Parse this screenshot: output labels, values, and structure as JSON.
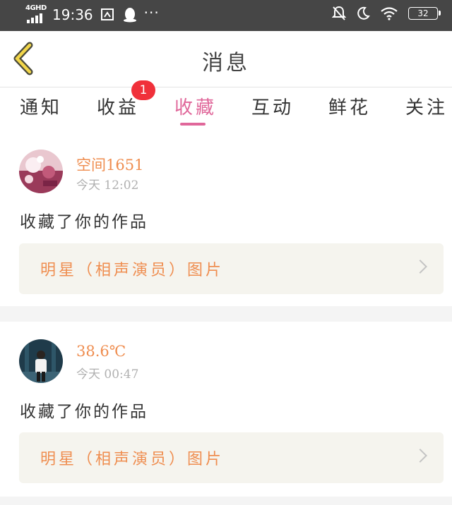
{
  "status_bar": {
    "network": "4GHD",
    "time": "19:36",
    "more": "···",
    "battery": "32"
  },
  "header": {
    "title": "消息"
  },
  "tabs": [
    {
      "label": "通知"
    },
    {
      "label": "收益",
      "badge": "1"
    },
    {
      "label": "收藏",
      "active": true
    },
    {
      "label": "互动"
    },
    {
      "label": "鲜花"
    },
    {
      "label": "关注"
    }
  ],
  "colors": {
    "accent_pink": "#e0679a",
    "username_orange": "#ef8d4f",
    "badge_red": "#f0303a"
  },
  "messages": [
    {
      "username": "空间1651",
      "time": "今天 12:02",
      "action": "收藏了你的作品",
      "work_title": "明星（相声演员）图片"
    },
    {
      "username": "38.6℃",
      "time": "今天 00:47",
      "action": "收藏了你的作品",
      "work_title": "明星（相声演员）图片"
    }
  ]
}
